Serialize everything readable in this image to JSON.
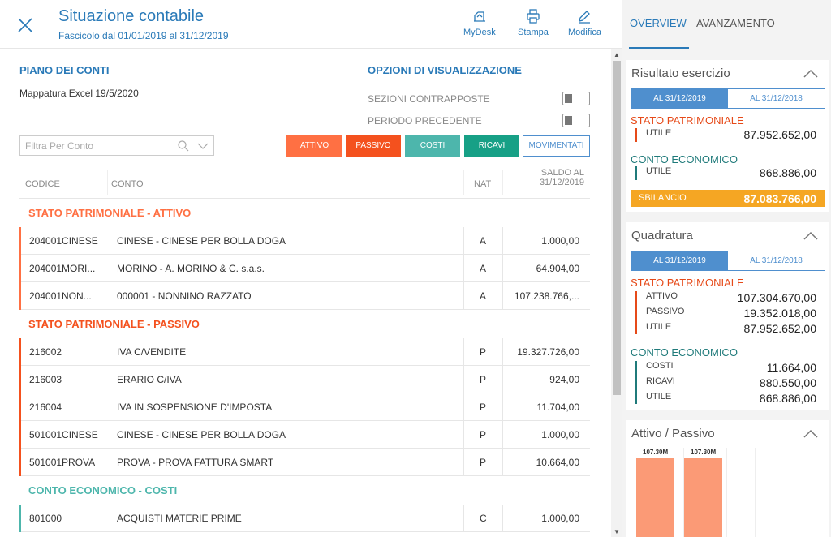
{
  "header": {
    "title": "Situazione contabile",
    "subtitle": "Fascicolo dal 01/01/2019 al 31/12/2019",
    "tools": [
      {
        "label": "MyDesk",
        "icon": "mydesk-icon"
      },
      {
        "label": "Stampa",
        "icon": "printer-icon"
      },
      {
        "label": "Modifica",
        "icon": "pencil-icon"
      }
    ]
  },
  "left": {
    "piano_title": "PIANO DEI CONTI",
    "mapping": "Mappatura Excel 19/5/2020",
    "options_title": "OPZIONI DI VISUALIZZAZIONE",
    "options": [
      {
        "label": "SEZIONI CONTRAPPOSTE",
        "on": false
      },
      {
        "label": "PERIODO PRECEDENTE",
        "on": false
      }
    ],
    "filter_placeholder": "Filtra Per Conto",
    "filter_buttons": [
      {
        "label": "ATTIVO",
        "color": "#ff7043"
      },
      {
        "label": "PASSIVO",
        "color": "#f4511e"
      },
      {
        "label": "COSTI",
        "color": "#4db6ac"
      },
      {
        "label": "RICAVI",
        "color": "#17a086"
      },
      {
        "label": "MOVIMENTATI",
        "color": "#ffffff"
      }
    ],
    "table_headers": {
      "codice": "CODICE",
      "conto": "CONTO",
      "nat": "NAT",
      "saldo_1": "SALDO AL",
      "saldo_2": "31/12/2019"
    },
    "groups": [
      {
        "title": "STATO PATRIMONIALE - ATTIVO",
        "color": "#ff7043",
        "rows": [
          {
            "codice": "204001CINESE",
            "conto": "CINESE - CINESE PER BOLLA DOGA",
            "nat": "A",
            "saldo": "1.000,00"
          },
          {
            "codice": "204001MORI...",
            "conto": "MORINO - A. MORINO & C. s.a.s.",
            "nat": "A",
            "saldo": "64.904,00"
          },
          {
            "codice": "204001NON...",
            "conto": "000001 - NONNINO RAZZATO",
            "nat": "A",
            "saldo": "107.238.766,..."
          }
        ]
      },
      {
        "title": "STATO PATRIMONIALE - PASSIVO",
        "color": "#f4511e",
        "rows": [
          {
            "codice": "216002",
            "conto": "IVA C/VENDITE",
            "nat": "P",
            "saldo": "19.327.726,00"
          },
          {
            "codice": "216003",
            "conto": "ERARIO C/IVA",
            "nat": "P",
            "saldo": "924,00"
          },
          {
            "codice": "216004",
            "conto": "IVA IN SOSPENSIONE D'IMPOSTA",
            "nat": "P",
            "saldo": "11.704,00"
          },
          {
            "codice": "501001CINESE",
            "conto": "CINESE - CINESE PER BOLLA DOGA",
            "nat": "P",
            "saldo": "1.000,00"
          },
          {
            "codice": "501001PROVA",
            "conto": "PROVA - PROVA FATTURA SMART",
            "nat": "P",
            "saldo": "10.664,00"
          }
        ]
      },
      {
        "title": "CONTO ECONOMICO - COSTI",
        "color": "#4db6ac",
        "rows": [
          {
            "codice": "801000",
            "conto": "ACQUISTI MATERIE PRIME",
            "nat": "C",
            "saldo": "1.000,00"
          }
        ]
      }
    ]
  },
  "right": {
    "tabs": [
      "OVERVIEW",
      "AVANZAMENTO"
    ],
    "risultato": {
      "title": "Risultato esercizio",
      "seg": [
        "AL 31/12/2019",
        "AL 31/12/2018"
      ],
      "sp_title": "STATO PATRIMONIALE",
      "sp_lbl": "UTILE",
      "sp_val": "87.952.652,00",
      "ce_title": "CONTO ECONOMICO",
      "ce_lbl": "UTILE",
      "ce_val": "868.886,00",
      "sbil_lbl": "SBILANCIO",
      "sbil_val": "87.083.766,00"
    },
    "quadratura": {
      "title": "Quadratura",
      "seg": [
        "AL 31/12/2019",
        "AL 31/12/2018"
      ],
      "sp_title": "STATO PATRIMONIALE",
      "sp_rows": [
        {
          "label": "ATTIVO",
          "value": "107.304.670,00"
        },
        {
          "label": "PASSIVO",
          "value": "19.352.018,00"
        },
        {
          "label": "UTILE",
          "value": "87.952.652,00"
        }
      ],
      "ce_title": "CONTO ECONOMICO",
      "ce_rows": [
        {
          "label": "COSTI",
          "value": "11.664,00"
        },
        {
          "label": "RICAVI",
          "value": "880.550,00"
        },
        {
          "label": "UTILE",
          "value": "868.886,00"
        }
      ]
    },
    "attivo_passivo": {
      "title": "Attivo / Passivo",
      "bar_labels": [
        "107.30M",
        "107.30M"
      ],
      "bar_values": [
        107.3,
        107.3
      ],
      "bar_color": "#fb9a76"
    }
  },
  "colors": {
    "brand": "#2a7ab8",
    "sp_red": "#e64a19",
    "ce_teal": "#1f7a7a",
    "seg_blue": "#4f8fce",
    "sbil": "#f5a623"
  }
}
